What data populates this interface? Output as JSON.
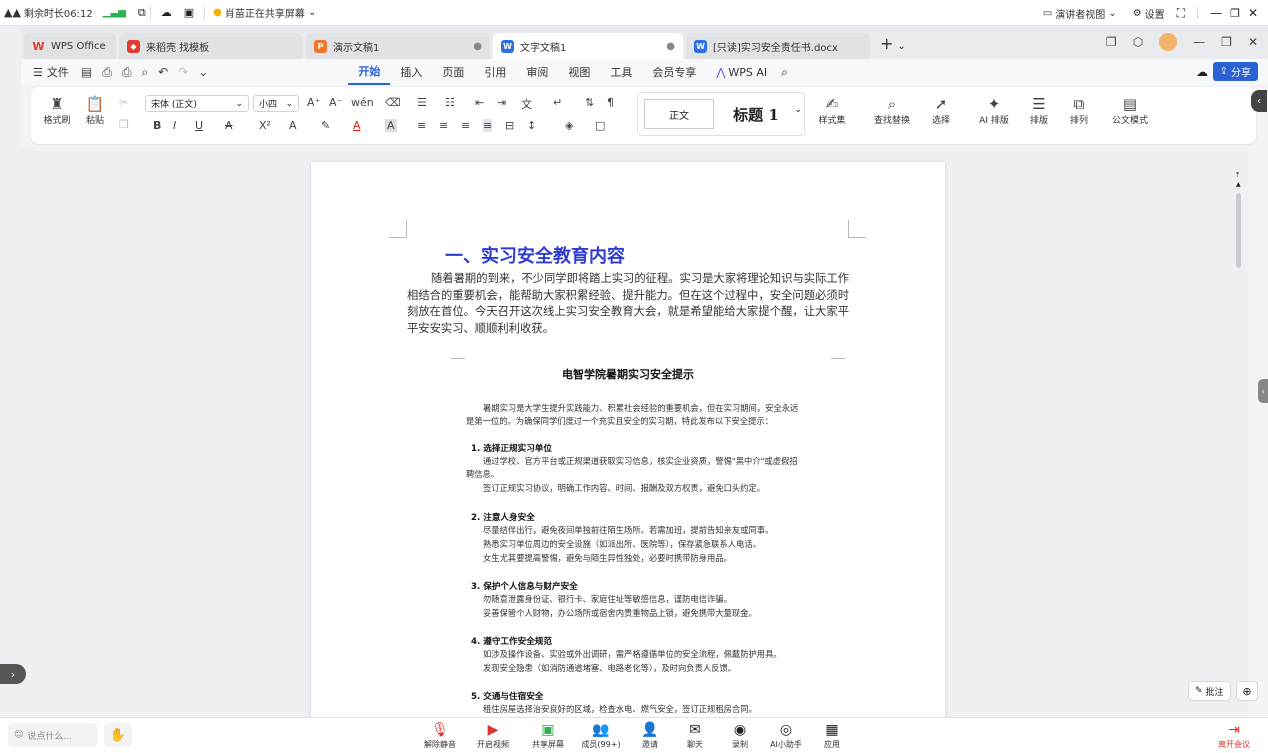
{
  "meeting_bar": {
    "remaining_time": "剩余时长06:12",
    "sharing_notice": "肖苗正在共享屏幕",
    "presenter_view": "演讲者视图",
    "settings": "设置"
  },
  "tabs": [
    {
      "label": "WPS Office",
      "icon": "wps-logo-icon",
      "color": "#e33b2e"
    },
    {
      "label": "来稻壳 找模板",
      "icon": "docer-icon",
      "color": "#e33b2e"
    },
    {
      "label": "演示文稿1",
      "icon": "presentation-icon",
      "color": "#f0762b"
    },
    {
      "label": "文字文稿1",
      "icon": "writer-icon",
      "color": "#2f6fe4"
    },
    {
      "label": "[只读]实习安全责任书.docx",
      "icon": "writer-icon",
      "color": "#2f6fe4"
    }
  ],
  "menu": {
    "file": "文件",
    "tabs": [
      "开始",
      "插入",
      "页面",
      "引用",
      "审阅",
      "视图",
      "工具",
      "会员专享"
    ],
    "active": "开始",
    "wps_ai": "WPS AI",
    "share": "分享"
  },
  "ribbon": {
    "format_painter": "格式刷",
    "paste": "粘贴",
    "font_name": "宋体 (正文)",
    "font_size": "小四",
    "style_normal": "正文",
    "style_heading": "标题 1",
    "style_set": "样式集",
    "find_replace": "查找替换",
    "select": "选择",
    "ai_layout": "AI 排版",
    "layout": "排版",
    "arrange": "排列",
    "official_mode": "公文模式"
  },
  "document": {
    "heading": "一、实习安全教育内容",
    "paragraph": "随着暑期的到来，不少同学即将踏上实习的征程。实习是大家将理论知识与实际工作相结合的重要机会，能帮助大家积累经验、提升能力。但在这个过程中，安全问题必须时刻放在首位。今天召开这次线上实习安全教育大会，就是希望能给大家提个醒，让大家平平安安实习、顺顺利利收获。",
    "notice_title": "电智学院暑期实习安全提示",
    "notice_intro_1": "暑期实习是大学生提升实践能力、积累社会经验的重要机会，但在实习期间，安全永远",
    "notice_intro_2": "是第一位的。为确保同学们度过一个充实且安全的实习期，特此发布以下安全提示：",
    "sections": [
      {
        "title": "1. 选择正规实习单位",
        "lines": [
          "通过学校、官方平台或正规渠道获取实习信息，核实企业资质，警惕\"黑中介\"或虚假招",
          "聘信息。",
          "签订正规实习协议，明确工作内容、时间、报酬及双方权责，避免口头约定。"
        ]
      },
      {
        "title": "2. 注意人身安全",
        "lines": [
          "尽量结伴出行，避免夜间单独前往陌生场所。若需加班，提前告知亲友或同事。",
          "熟悉实习单位周边的安全设施（如派出所、医院等），保存紧急联系人电话。",
          "女生尤其要提高警惕，避免与陌生异性独处，必要时携带防身用品。"
        ]
      },
      {
        "title": "3. 保护个人信息与财产安全",
        "lines": [
          "勿随意泄露身份证、银行卡、家庭住址等敏感信息，谨防电信诈骗。",
          "妥善保管个人财物，办公场所或宿舍内贵重物品上锁，避免携带大量现金。"
        ]
      },
      {
        "title": "4. 遵守工作安全规范",
        "lines": [
          "如涉及操作设备、实验或外出调研，需严格遵循单位的安全流程，佩戴防护用具。",
          "发现安全隐患（如消防通道堵塞、电路老化等），及时向负责人反馈。"
        ]
      },
      {
        "title": "5. 交通与住宿安全",
        "lines": [
          "租住房屋选择治安良好的区域，检查水电、燃气安全，签订正规租房合同。"
        ]
      }
    ]
  },
  "float_tools": {
    "annotate": "批注"
  },
  "bottom_bar": {
    "input_placeholder": "说点什么...",
    "items": [
      "解除静音",
      "开启视频",
      "共享屏幕",
      "成员(99+)",
      "邀请",
      "聊天",
      "录制",
      "AI小助手",
      "应用"
    ],
    "leave": "离开会议"
  }
}
